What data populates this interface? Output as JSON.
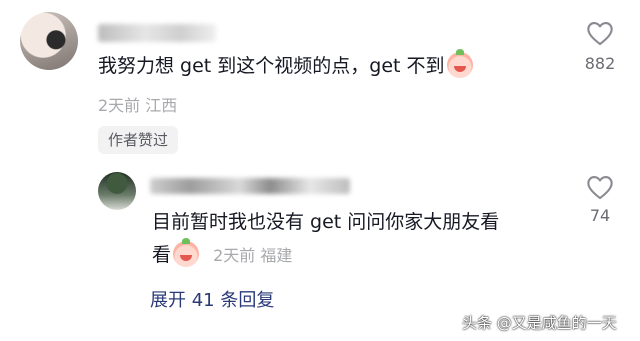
{
  "comment": {
    "text": "我努力想 get 到这个视频的点，get 不到",
    "emoji_icon": "shy-face-emoji",
    "time": "2天前",
    "location": "江西",
    "badge": "作者赞过",
    "likes": "882"
  },
  "reply": {
    "text_line1": "目前暂时我也没有 get  问问你家大朋友看",
    "text_line2": "看",
    "emoji_icon": "crying-face-emoji",
    "time": "2天前",
    "location": "福建",
    "likes": "74"
  },
  "expand_replies": "展开 41 条回复",
  "watermark": "头条 @又是咸鱼的一天",
  "icons": {
    "like": "heart-outline-icon"
  },
  "colors": {
    "meta_gray": "#a8a9ad",
    "link_blue": "#2a3a78",
    "badge_bg": "#f2f2f3"
  }
}
